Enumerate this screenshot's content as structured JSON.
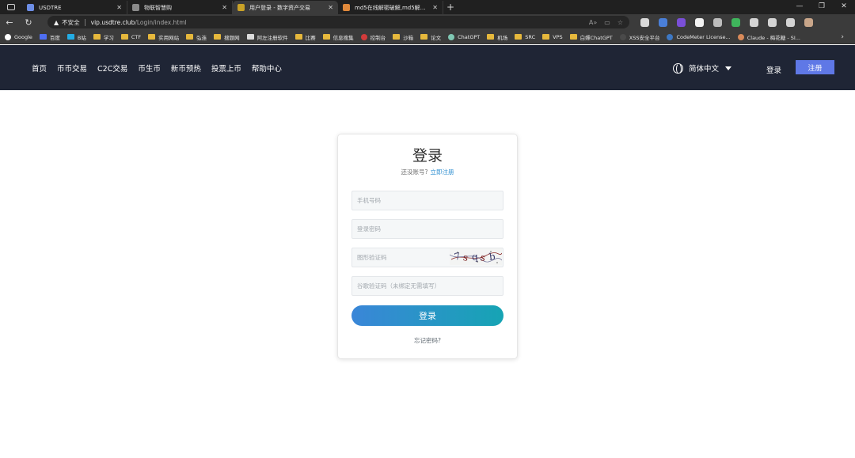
{
  "browser": {
    "tabs": [
      {
        "title": "USDTRE",
        "favicon_color": "#6d8ee6",
        "active": false
      },
      {
        "title": "物联智慧购",
        "favicon_color": "#8a8a8a",
        "active": false
      },
      {
        "title": "用户登录 - 数字资产交易",
        "favicon_color": "#c9a227",
        "active": true
      },
      {
        "title": "md5在线解密破解,md5解密加密",
        "favicon_color": "#e0893b",
        "active": false
      }
    ],
    "new_tab_icon": "+",
    "window_controls": [
      "—",
      "❐",
      "✕"
    ],
    "address": {
      "security_label": "不安全",
      "host": "vip.usdtre.club",
      "path": "/Login/index.html"
    },
    "extension_icon_colors": [
      "#d9d9d9",
      "#4a7fd8",
      "#7a4fd8",
      "#f2f2f2",
      "#bdbdbd",
      "#3fb55c",
      "#d4d4d4",
      "#d4d4d4",
      "#d4d4d4",
      "#c9a68a"
    ],
    "bookmarks": [
      {
        "label": "Google",
        "icon": "google-icon",
        "color": "#ffffff",
        "shape": "round"
      },
      {
        "label": "百度",
        "icon": "baidu-icon",
        "color": "#4e6ef2",
        "shape": "square"
      },
      {
        "label": "B站",
        "icon": "bilibili-icon",
        "color": "#23ade5",
        "shape": "square"
      },
      {
        "label": "学习",
        "icon": "folder-icon",
        "color": "#e6b83c",
        "shape": "folder"
      },
      {
        "label": "CTF",
        "icon": "folder-icon",
        "color": "#e6b83c",
        "shape": "folder"
      },
      {
        "label": "实用网站",
        "icon": "folder-icon",
        "color": "#e6b83c",
        "shape": "folder"
      },
      {
        "label": "弘连",
        "icon": "folder-icon",
        "color": "#e6b83c",
        "shape": "folder"
      },
      {
        "label": "搜题网",
        "icon": "folder-icon",
        "color": "#e6b83c",
        "shape": "folder"
      },
      {
        "label": "阿左注册软件",
        "icon": "page-icon",
        "color": "#dcdcdc",
        "shape": "square"
      },
      {
        "label": "比赛",
        "icon": "folder-icon",
        "color": "#e6b83c",
        "shape": "folder"
      },
      {
        "label": "信息搜集",
        "icon": "folder-icon",
        "color": "#e6b83c",
        "shape": "folder"
      },
      {
        "label": "控制台",
        "icon": "huawei-icon",
        "color": "#d23b3b",
        "shape": "round"
      },
      {
        "label": "沙箱",
        "icon": "folder-icon",
        "color": "#e6b83c",
        "shape": "folder"
      },
      {
        "label": "论文",
        "icon": "folder-icon",
        "color": "#e6b83c",
        "shape": "folder"
      },
      {
        "label": "ChatGPT",
        "icon": "chatgpt-icon",
        "color": "#7fc7b3",
        "shape": "round"
      },
      {
        "label": "机场",
        "icon": "folder-icon",
        "color": "#e6b83c",
        "shape": "folder"
      },
      {
        "label": "SRC",
        "icon": "folder-icon",
        "color": "#e6b83c",
        "shape": "folder"
      },
      {
        "label": "VPS",
        "icon": "folder-icon",
        "color": "#e6b83c",
        "shape": "folder"
      },
      {
        "label": "白嫖ChatGPT",
        "icon": "folder-icon",
        "color": "#e6b83c",
        "shape": "folder"
      },
      {
        "label": "XSS安全平台",
        "icon": "xss-icon",
        "color": "#4a4a4a",
        "shape": "round"
      },
      {
        "label": "CodeMeter License...",
        "icon": "python-icon",
        "color": "#3d78c4",
        "shape": "round"
      },
      {
        "label": "Claude - 梅花糖 - SI...",
        "icon": "claude-icon",
        "color": "#d88a5a",
        "shape": "round"
      }
    ],
    "bookmarks_more": "›"
  },
  "header": {
    "nav": [
      "首页",
      "币币交易",
      "C2C交易",
      "币生币",
      "新币预热",
      "投票上币",
      "帮助中心"
    ],
    "language": "简体中文",
    "login": "登录",
    "register": "注册"
  },
  "login_card": {
    "title": "登录",
    "no_account": "还没账号?",
    "register_link": "立即注册",
    "phone_placeholder": "手机号码",
    "password_placeholder": "登录密码",
    "captcha_placeholder": "图形验证码",
    "google_code_placeholder": "谷歌验证码（未绑定无需填写）",
    "captcha_text": "7sqsb",
    "submit": "登录",
    "forgot": "忘记密码?"
  },
  "colors": {
    "header_bg": "#1f2535",
    "register_button": "#5f78e6",
    "login_gradient_start": "#3a86d8",
    "login_gradient_end": "#16a4b4",
    "link": "#2f8fd1"
  }
}
